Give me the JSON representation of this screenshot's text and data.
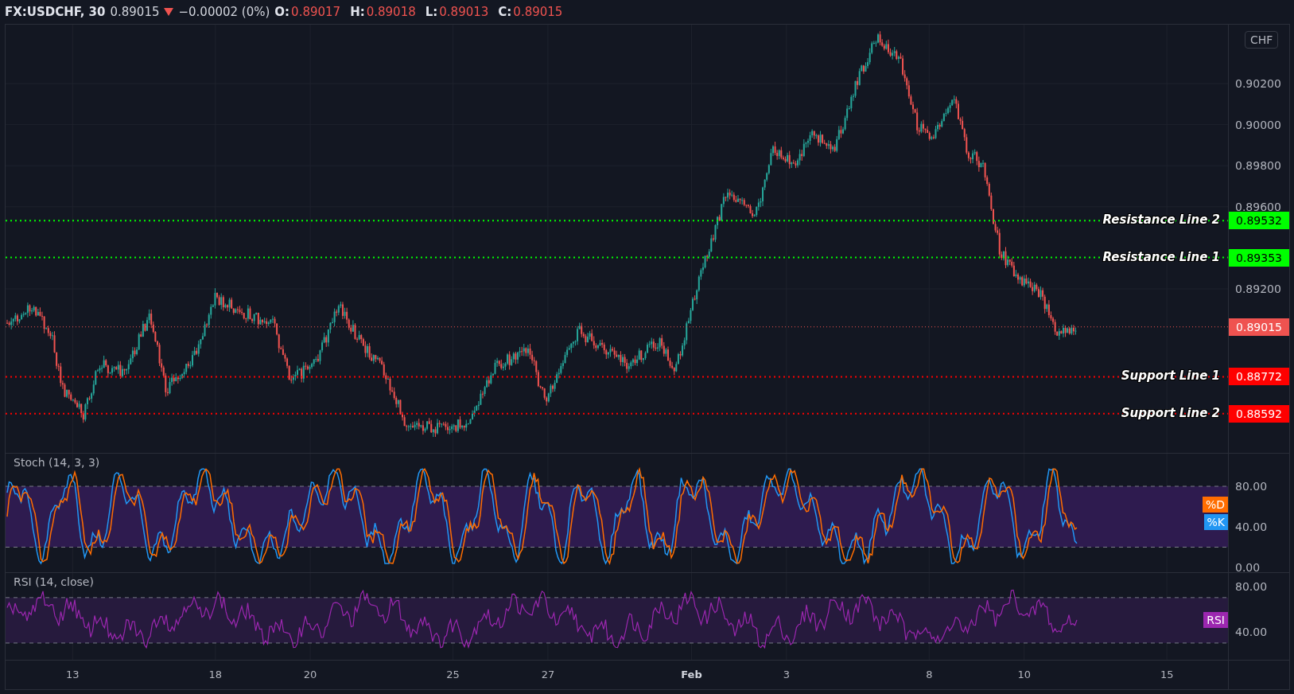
{
  "header": {
    "symbol": "FX:USDCHF, 30",
    "price": "0.89015",
    "falling": true,
    "change": "−0.00002 (0%)",
    "ohlc": [
      {
        "label": "O:",
        "value": "0.89017"
      },
      {
        "label": "H:",
        "value": "0.89018"
      },
      {
        "label": "L:",
        "value": "0.89013"
      },
      {
        "label": "C:",
        "value": "0.89015"
      }
    ]
  },
  "price_axis": {
    "currency_button": "CHF",
    "labels": [
      "0.90200",
      "0.90000",
      "0.89800",
      "0.89600",
      "0.89200"
    ]
  },
  "levels": [
    {
      "label": "Resistance Line 2",
      "price": "0.89532",
      "color": "#00ff00"
    },
    {
      "label": "Resistance Line 1",
      "price": "0.89353",
      "color": "#00ff00"
    },
    {
      "label": "Support Line 1",
      "price": "0.88772",
      "color": "#ff0000"
    },
    {
      "label": "Support Line 2",
      "price": "0.88592",
      "color": "#ff0000"
    }
  ],
  "current_price": {
    "price": "0.89015",
    "color": "#ef5350"
  },
  "stoch": {
    "title": "Stoch (14, 3, 3)",
    "tags": [
      {
        "label": "%D",
        "color": "#ff6d00"
      },
      {
        "label": "%K",
        "color": "#2196f3"
      }
    ],
    "axis_labels": [
      "80.00",
      "40.00",
      "0.00"
    ]
  },
  "rsi": {
    "title": "RSI (14, close)",
    "tag": "RSI",
    "axis_labels": [
      "80.00",
      "40.00"
    ]
  },
  "time_axis": [
    {
      "label": "13",
      "kind": "day"
    },
    {
      "label": "18",
      "kind": "day"
    },
    {
      "label": "20",
      "kind": "day"
    },
    {
      "label": "25",
      "kind": "day"
    },
    {
      "label": "27",
      "kind": "day"
    },
    {
      "label": "Feb",
      "kind": "month"
    },
    {
      "label": "3",
      "kind": "day"
    },
    {
      "label": "8",
      "kind": "day"
    },
    {
      "label": "10",
      "kind": "day"
    },
    {
      "label": "15",
      "kind": "day"
    }
  ]
}
